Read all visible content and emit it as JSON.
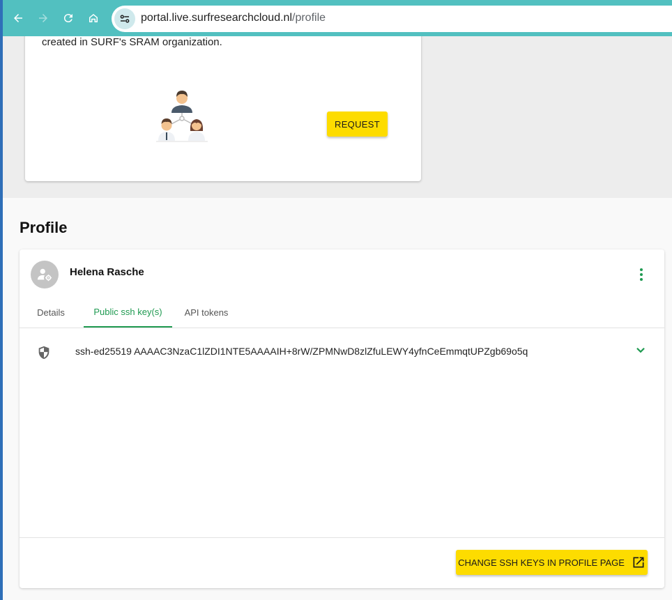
{
  "browser": {
    "url_host": "portal.live.surfresearchcloud.nl",
    "url_path": "/profile"
  },
  "access_card": {
    "description": "created in SURF's SRAM organization.",
    "request_label": "REQUEST"
  },
  "profile": {
    "title": "Profile",
    "user_name": "Helena Rasche",
    "tabs": [
      {
        "label": "Details",
        "active": false
      },
      {
        "label": "Public ssh key(s)",
        "active": true
      },
      {
        "label": "API tokens",
        "active": false
      }
    ],
    "ssh_key": "ssh-ed25519 AAAAC3NzaC1lZDI1NTE5AAAAIH+8rW/ZPMNwD8zlZfuLEWY4yfnCeEmmqtUPZgb69o5q",
    "change_keys_label": "CHANGE SSH KEYS IN PROFILE PAGE"
  },
  "colors": {
    "toolbar": "#52c0c0",
    "accent_green": "#1f9a51",
    "button_yellow": "#fddc00"
  },
  "icons": {
    "back": "arrow-left-icon",
    "forward": "arrow-right-icon",
    "reload": "reload-icon",
    "home": "home-icon",
    "site_controls": "tune-icon",
    "group": "group-people-icon",
    "avatar": "user-gear-icon",
    "menu": "kebab-menu-icon",
    "shield": "shield-icon",
    "chevron": "chevron-down-icon",
    "external": "open-external-icon"
  }
}
